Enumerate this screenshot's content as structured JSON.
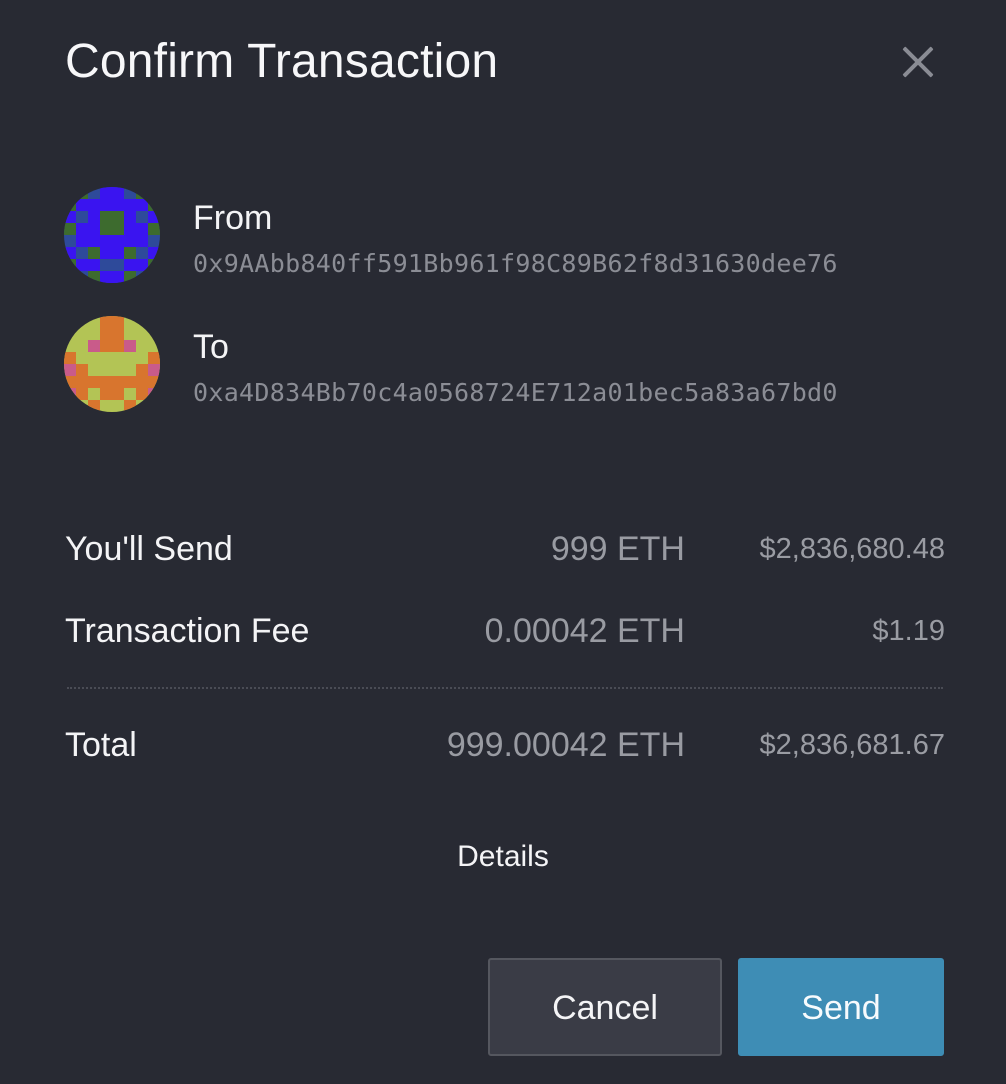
{
  "dialog": {
    "title": "Confirm Transaction",
    "close_icon": "close-icon"
  },
  "from": {
    "label": "From",
    "address": "0x9AAbb840ff591Bb961f98C89B62f8d31630dee76",
    "avatar_colors": {
      "background": "#2e4a9a",
      "primary": "#3a14f0",
      "secondary": "#3d6b2e"
    }
  },
  "to": {
    "label": "To",
    "address": "0xa4D834Bb70c4a0568724E712a01bec5a83a67bd0",
    "avatar_colors": {
      "background": "#b3c455",
      "primary": "#d8752e",
      "secondary": "#c95b8a"
    }
  },
  "summary": {
    "send": {
      "label": "You'll Send",
      "eth": "999 ETH",
      "usd": "$2,836,680.48"
    },
    "fee": {
      "label": "Transaction Fee",
      "eth": "0.00042 ETH",
      "usd": "$1.19"
    },
    "total": {
      "label": "Total",
      "eth": "999.00042 ETH",
      "usd": "$2,836,681.67"
    }
  },
  "details_label": "Details",
  "buttons": {
    "cancel": "Cancel",
    "send": "Send"
  },
  "colors": {
    "background": "#282a33",
    "accent": "#3e8db5",
    "muted_text": "#8b8d95"
  }
}
